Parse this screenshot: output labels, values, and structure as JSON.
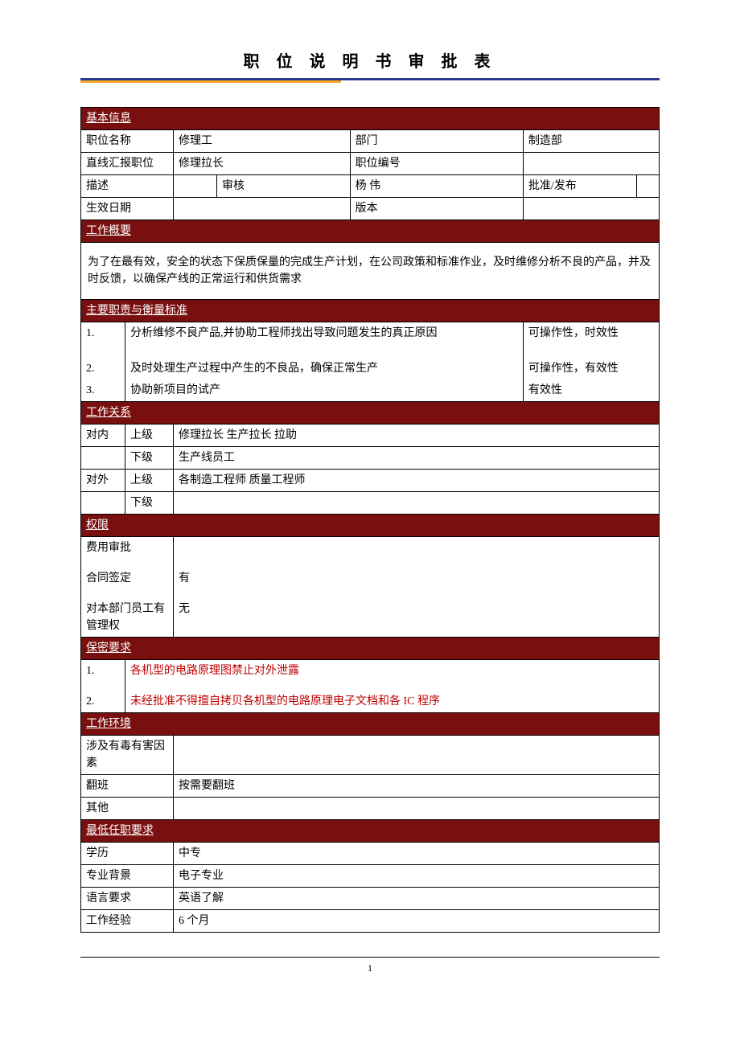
{
  "title": "职 位 说 明 书 审 批 表",
  "sections": {
    "basic": "基本信息",
    "overview": "工作概要",
    "resp": "主要职责与衡量标准",
    "relation": "工作关系",
    "authority": "权限",
    "confidential": "保密要求",
    "env": "工作环境",
    "minreq": "最低任职要求"
  },
  "basic": {
    "pos_label": "职位名称",
    "pos_value": "修理工",
    "dept_label": "部门",
    "dept_value": "制造部",
    "report_label": "直线汇报职位",
    "report_value": "修理拉长",
    "posno_label": "职位编号",
    "posno_value": "",
    "desc_label": "描述",
    "review_label": "审核",
    "review_value": "杨 伟",
    "approve_label": "批准/发布",
    "effdate_label": "生效日期",
    "effdate_value": "",
    "version_label": "版本",
    "version_value": ""
  },
  "overview": {
    "text": "为了在最有效，安全的状态下保质保量的完成生产计划，在公司政策和标准作业，及时维修分析不良的产品，并及时反馈，以确保产线的正常运行和供货需求"
  },
  "resp": [
    {
      "num": "1.",
      "text": "分析维修不良产品,并协助工程师找出导致问题发生的真正原因",
      "metric": "可操作性，时效性"
    },
    {
      "num": "2.",
      "text": "及时处理生产过程中产生的不良品，确保正常生产",
      "metric": "可操作性，有效性"
    },
    {
      "num": "3.",
      "text": "协助新项目的试产",
      "metric": "有效性"
    }
  ],
  "relation": {
    "internal_label": "对内",
    "external_label": "对外",
    "superior_label": "上级",
    "subordinate_label": "下级",
    "internal_sup": "修理拉长 生产拉长 拉助",
    "internal_sub": "生产线员工",
    "external_sup": "各制造工程师 质量工程师",
    "external_sub": ""
  },
  "authority": {
    "expense_label": "费用审批",
    "expense_value": "",
    "contract_label": "合同签定",
    "contract_value": "有",
    "manage_label": "对本部门员工有管理权",
    "manage_value": "无"
  },
  "confidential": [
    {
      "num": "1.",
      "text": "各机型的电路原理图禁止对外泄露"
    },
    {
      "num": "2.",
      "text": "未经批准不得擅自拷贝各机型的电路原理电子文档和各 IC 程序"
    }
  ],
  "env": {
    "hazard_label": "涉及有毒有害因素",
    "hazard_value": "",
    "shift_label": "翻班",
    "shift_value": "按需要翻班",
    "other_label": "其他",
    "other_value": ""
  },
  "minreq": {
    "edu_label": "学历",
    "edu_value": "中专",
    "bg_label": "专业背景",
    "bg_value": "电子专业",
    "lang_label": "语言要求",
    "lang_value": "英语了解",
    "exp_label": "工作经验",
    "exp_value": "6 个月"
  },
  "footer": {
    "page": "1"
  }
}
